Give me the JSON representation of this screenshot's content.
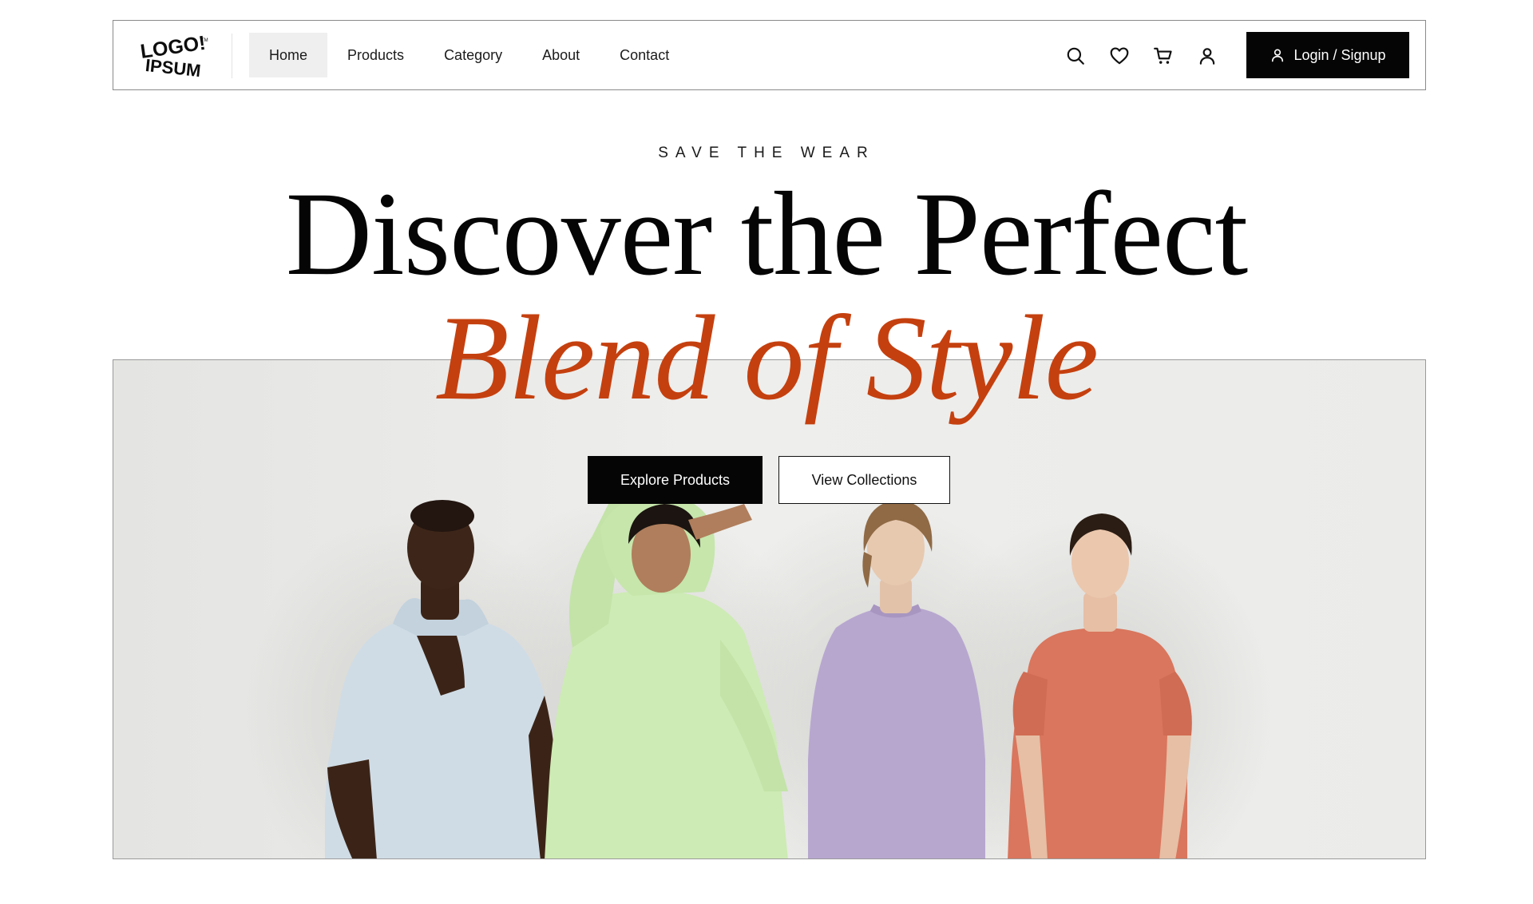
{
  "brand": {
    "logo_line1": "LOGO!",
    "logo_line2": "IPSUM",
    "logo_mark": "TM"
  },
  "nav": {
    "links": [
      {
        "label": "Home",
        "active": true
      },
      {
        "label": "Products",
        "active": false
      },
      {
        "label": "Category",
        "active": false
      },
      {
        "label": "About",
        "active": false
      },
      {
        "label": "Contact",
        "active": false
      }
    ],
    "icons": [
      "search-icon",
      "heart-icon",
      "cart-icon",
      "user-icon"
    ],
    "login_label": "Login / Signup"
  },
  "hero": {
    "eyebrow": "SAVE THE WEAR",
    "headline": "Discover the Perfect",
    "headline_accent": "Blend of Style",
    "primary_cta": "Explore Products",
    "secondary_cta": "View Collections"
  },
  "colors": {
    "accent": "#c5400f",
    "primary_button": "#050505",
    "active_nav_bg": "#efefef",
    "shirt_blue": "#cfdce6",
    "shirt_green": "#cdebb4",
    "shirt_lavender": "#b7a7cf",
    "shirt_coral": "#d9765d"
  }
}
